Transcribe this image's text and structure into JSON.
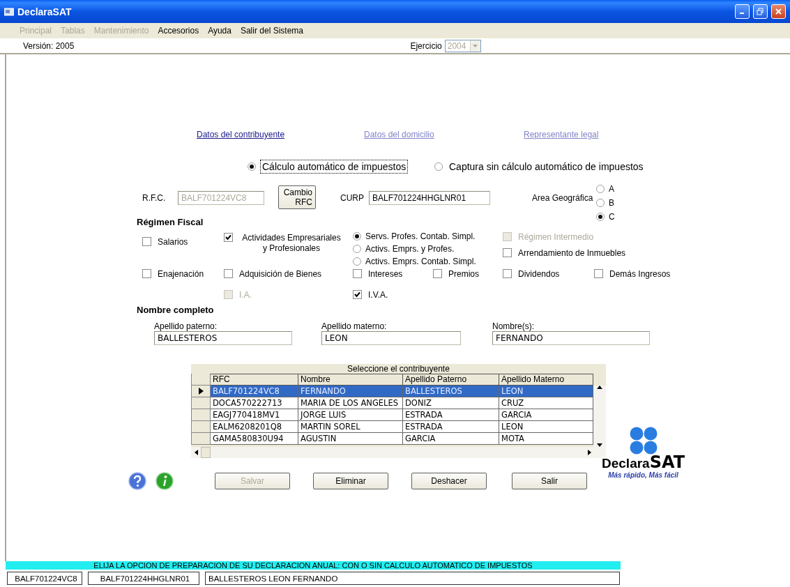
{
  "window": {
    "title": "DeclaraSAT"
  },
  "menu": [
    {
      "label": "Principal",
      "disabled": true
    },
    {
      "label": "Tablas",
      "disabled": true
    },
    {
      "label": "Mantenimiento",
      "disabled": true
    },
    {
      "label": "Accesorios",
      "disabled": false
    },
    {
      "label": "Ayuda",
      "disabled": false
    },
    {
      "label": "Salir del Sistema",
      "disabled": false
    }
  ],
  "version": "Versión: 2005",
  "ejercicio": {
    "label": "Ejercicio",
    "value": "2004",
    "disabled": true
  },
  "section_links": [
    {
      "label": "Datos del contribuyente",
      "disabled": false
    },
    {
      "label": "Datos del domicilio",
      "disabled": true
    },
    {
      "label": "Representante legal",
      "disabled": true
    }
  ],
  "calc_mode": [
    {
      "label": "Cálculo automático de impuestos",
      "selected": true,
      "focused": true
    },
    {
      "label": "Captura sin cálculo automático de impuestos",
      "selected": false,
      "focused": false
    }
  ],
  "rfc": {
    "label": "R.F.C.",
    "value": "BALF701224VC8",
    "disabled": true
  },
  "change_rfc_button": {
    "label": "Cambio RFC"
  },
  "curp": {
    "label": "CURP",
    "value": "BALF701224HHGLNR01"
  },
  "area_geografica": {
    "label": "Area Geográfica",
    "options": [
      {
        "label": "A",
        "selected": false
      },
      {
        "label": "B",
        "selected": false
      },
      {
        "label": "C",
        "selected": true
      }
    ]
  },
  "regimen_fiscal": {
    "title": "Régimen Fiscal",
    "salarios": {
      "label": "Salarios",
      "checked": false,
      "disabled": false
    },
    "actividades": {
      "label": "Actividades Empresariales y Profesionales",
      "checked": true,
      "disabled": false
    },
    "actividades_options": [
      {
        "label": "Servs. Profes. Contab. Simpl.",
        "selected": true
      },
      {
        "label": "Activs. Emprs. y Profes.",
        "selected": false
      },
      {
        "label": "Activs. Emprs. Contab. Simpl.",
        "selected": false
      }
    ],
    "regimen_intermedio": {
      "label": "Régimen Intermedio",
      "checked": false,
      "disabled": true
    },
    "arrendamiento": {
      "label": "Arrendamiento de Inmuebles",
      "checked": false,
      "disabled": false
    },
    "income_checks": [
      {
        "label": "Enajenación",
        "checked": false,
        "disabled": false
      },
      {
        "label": "Adquisición de Bienes",
        "checked": false,
        "disabled": false
      },
      {
        "label": "Intereses",
        "checked": false,
        "disabled": false
      },
      {
        "label": "Premios",
        "checked": false,
        "disabled": false
      },
      {
        "label": "Dividendos",
        "checked": false,
        "disabled": false
      },
      {
        "label": "Demás Ingresos",
        "checked": false,
        "disabled": false
      }
    ],
    "tax_checks": [
      {
        "label": "I.A.",
        "checked": false,
        "disabled": true
      },
      {
        "label": "I.V.A.",
        "checked": true,
        "disabled": false
      }
    ]
  },
  "nombre_completo": {
    "title": "Nombre completo",
    "fields": [
      {
        "label": "Apellido paterno:",
        "value": "BALLESTEROS"
      },
      {
        "label": "Apellido materno:",
        "value": "LEON"
      },
      {
        "label": "Nombre(s):",
        "value": "FERNANDO"
      }
    ]
  },
  "grid": {
    "caption": "Seleccione el contribuyente",
    "columns": [
      "RFC",
      "Nombre",
      "Apellido Paterno",
      "Apellido Materno"
    ],
    "rows": [
      {
        "cells": [
          "BALF701224VC8",
          "FERNANDO",
          "BALLESTEROS",
          "LEON"
        ],
        "selected": true
      },
      {
        "cells": [
          "DOCA570222713",
          "MARIA DE LOS ANGELES",
          "DONIZ",
          "CRUZ"
        ],
        "selected": false
      },
      {
        "cells": [
          "EAGJ770418MV1",
          "JORGE LUIS",
          "ESTRADA",
          "GARCIA"
        ],
        "selected": false
      },
      {
        "cells": [
          "EALM6208201Q8",
          "MARTIN SOREL",
          "ESTRADA",
          "LEON"
        ],
        "selected": false
      },
      {
        "cells": [
          "GAMA580830U94",
          "AGUSTIN",
          "GARCIA",
          "MOTA"
        ],
        "selected": false
      }
    ]
  },
  "buttons": [
    {
      "label": "Salvar",
      "disabled": true
    },
    {
      "label": "Eliminar",
      "disabled": false
    },
    {
      "label": "Deshacer",
      "disabled": false
    },
    {
      "label": "Salir",
      "disabled": false
    }
  ],
  "logo": {
    "name": "Declara",
    "accent": "SAT",
    "tagline": "Más rápido, Más fácil"
  },
  "status_message": "ELIJA LA OPCION DE PREPARACION DE SU DECLARACION ANUAL: CON O SIN CALCULO AUTOMATICO DE IMPUESTOS",
  "status_fields": [
    "BALF701224VC8",
    "BALF701224HHGLNR01",
    "BALLESTEROS LEON FERNANDO"
  ]
}
